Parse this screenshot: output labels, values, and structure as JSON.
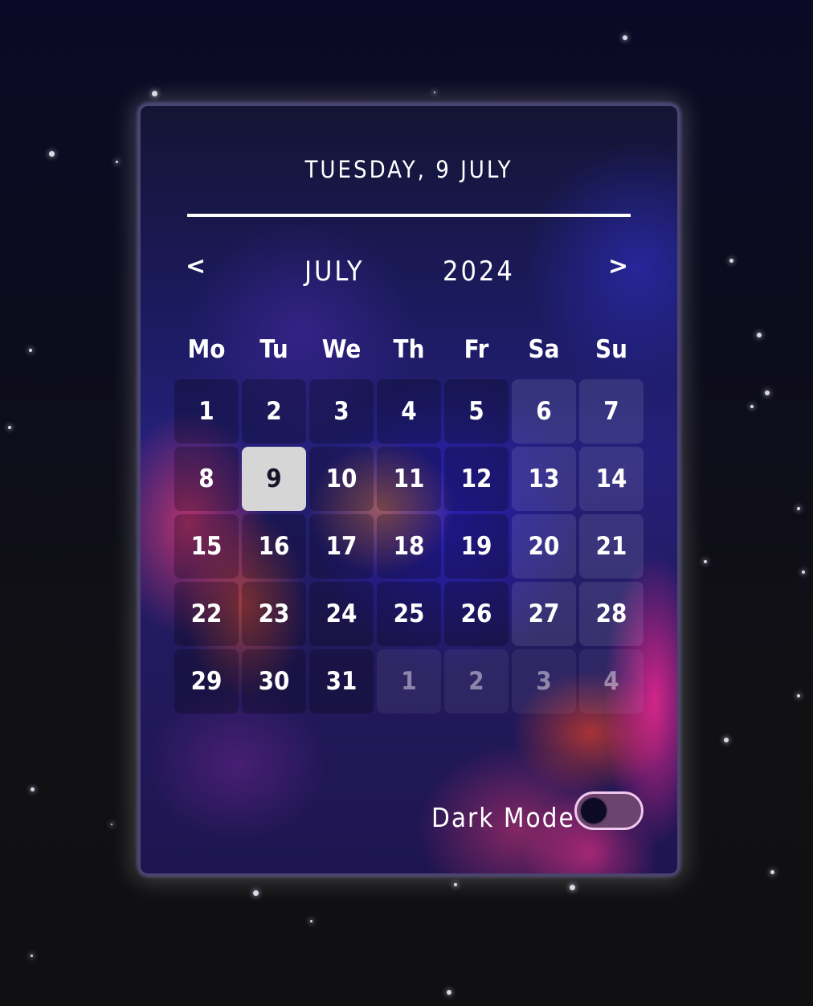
{
  "header": {
    "selected_date": "TUESDAY, 9 JULY"
  },
  "navigation": {
    "prev_label": "<",
    "next_label": ">",
    "month": "JULY",
    "year": "2024"
  },
  "weekdays": [
    "Mo",
    "Tu",
    "We",
    "Th",
    "Fr",
    "Sa",
    "Su"
  ],
  "days": [
    "1",
    "2",
    "3",
    "4",
    "5",
    "6",
    "7",
    "8",
    "9",
    "10",
    "11",
    "12",
    "13",
    "14",
    "15",
    "16",
    "17",
    "18",
    "19",
    "20",
    "21",
    "22",
    "23",
    "24",
    "25",
    "26",
    "27",
    "28",
    "29",
    "30",
    "31",
    "1",
    "2",
    "3",
    "4"
  ],
  "selected_day": "9",
  "settings": {
    "dark_mode_label": "Dark Mode",
    "dark_mode_on": false
  },
  "colors": {
    "selected_day_bg": "#d6d6d6",
    "toggle_track": "#6c456f",
    "toggle_border": "#f0c8ee"
  }
}
